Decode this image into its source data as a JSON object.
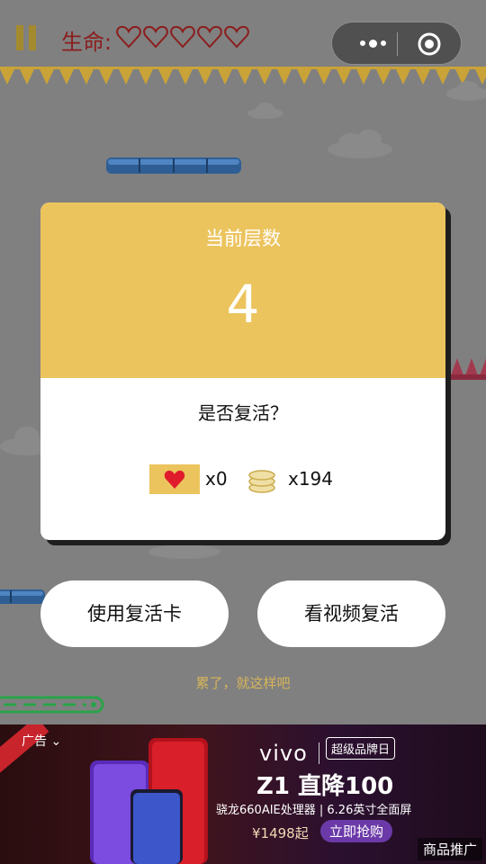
{
  "hud": {
    "lives_label": "生命:",
    "lives_filled": 0,
    "lives_max": 5
  },
  "modal": {
    "title": "当前层数",
    "level": "4",
    "question": "是否复活？",
    "revive_cards": "x0",
    "coins": "x194"
  },
  "buttons": {
    "use_card": "使用复活卡",
    "watch_video": "看视频复活"
  },
  "give_up": "累了，就这样吧",
  "ad": {
    "label": "广告",
    "brand": "vivo",
    "badge": "超级品牌日",
    "headline": "Z1 直降100",
    "spec": "骁龙660AIE处理器 | 6.26英寸全面屏",
    "price": "¥1498起",
    "cta": "立即抢购",
    "promo": "商品推广"
  },
  "colors": {
    "accent_yellow": "#ecc45e",
    "heart_red": "#e01b2b",
    "lives_text": "#8b1d1d"
  },
  "icons": [
    "pause-icon",
    "heart-outline-icon",
    "more-dots-icon",
    "target-icon",
    "heart-icon",
    "coin-stack-icon",
    "chevron-down-icon"
  ]
}
